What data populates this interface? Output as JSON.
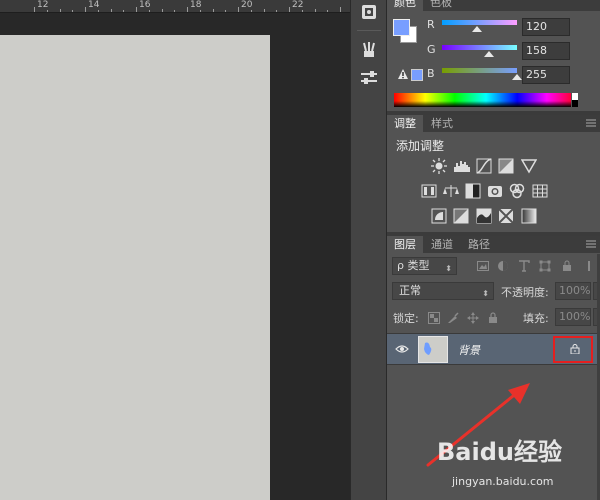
{
  "ruler": {
    "marks": [
      "12",
      "14",
      "16",
      "18",
      "20",
      "22"
    ]
  },
  "tool_strip": {
    "icons": [
      "color-panel-icon",
      "brush-preset-icon",
      "adjustments-slider-icon"
    ]
  },
  "color_panel": {
    "tabs": [
      "颜色",
      "色板"
    ],
    "foreground_color": "#789eff",
    "background_color": "#ffffff",
    "channels": [
      {
        "label": "R",
        "value": "120",
        "fraction": 0.47
      },
      {
        "label": "G",
        "value": "158",
        "fraction": 0.62
      },
      {
        "label": "B",
        "value": "255",
        "fraction": 1.0
      }
    ]
  },
  "adjustments_panel": {
    "tabs": [
      "调整",
      "样式"
    ],
    "title": "添加调整",
    "icons": [
      "brightness-contrast-icon",
      "levels-icon",
      "curves-icon",
      "exposure-icon",
      "vibrance-icon",
      "hue-saturation-icon",
      "color-balance-icon",
      "black-white-icon",
      "photo-filter-icon",
      "channel-mixer-icon",
      "color-lookup-icon",
      "invert-icon",
      "posterize-icon",
      "threshold-icon",
      "selective-color-icon",
      "gradient-map-icon"
    ]
  },
  "layers_panel": {
    "tabs": [
      "图层",
      "通道",
      "路径"
    ],
    "filter_label": "ρ 类型",
    "blend_mode": "正常",
    "opacity_label": "不透明度:",
    "opacity_value": "100%",
    "lock_label": "锁定:",
    "fill_label": "填充:",
    "fill_value": "100%",
    "layers": [
      {
        "name": "背景",
        "locked": true,
        "visible": true
      }
    ]
  },
  "watermark": {
    "logo": "Baidu经验",
    "url": "jingyan.baidu.com"
  },
  "colors": {
    "highlight_red": "#e51f1f",
    "annotation_arrow": "#e8312a"
  }
}
